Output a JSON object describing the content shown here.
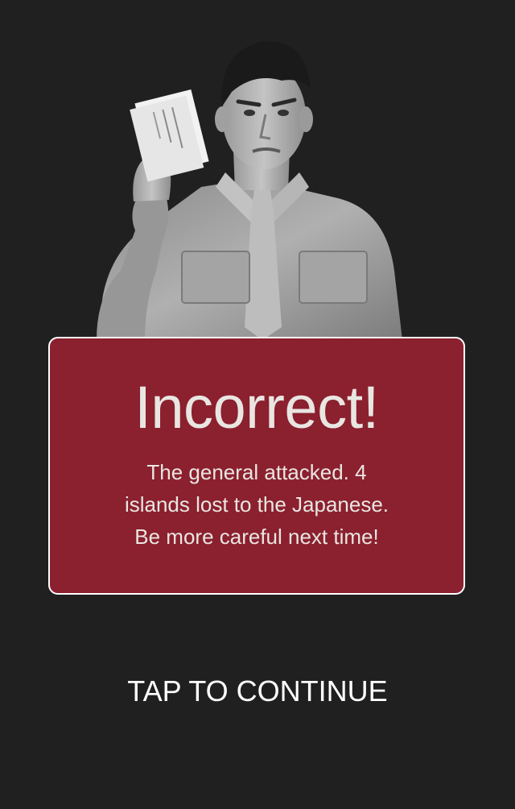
{
  "result": {
    "title": "Incorrect!",
    "message_lines": [
      "The general attacked. 4",
      "islands lost to the Japanese.",
      "Be more careful next time!"
    ]
  },
  "continue_label": "TAP TO CONTINUE",
  "colors": {
    "background": "#202020",
    "card": "#8b202e",
    "card_border": "#ffffff",
    "text": "#e9e6e2"
  }
}
